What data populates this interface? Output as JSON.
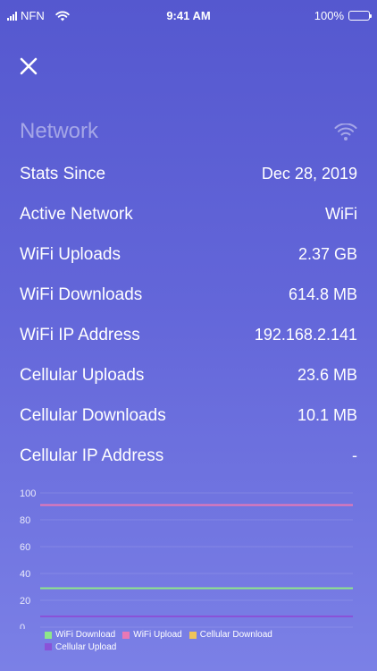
{
  "status_bar": {
    "carrier": "NFN",
    "time": "9:41 AM",
    "battery": "100%"
  },
  "header": {
    "title": "Network"
  },
  "stats": [
    {
      "label": "Stats Since",
      "value": "Dec 28, 2019"
    },
    {
      "label": "Active Network",
      "value": "WiFi"
    },
    {
      "label": "WiFi Uploads",
      "value": "2.37 GB"
    },
    {
      "label": "WiFi Downloads",
      "value": "614.8 MB"
    },
    {
      "label": "WiFi IP Address",
      "value": "192.168.2.141"
    },
    {
      "label": "Cellular Uploads",
      "value": "23.6 MB"
    },
    {
      "label": "Cellular Downloads",
      "value": "10.1 MB"
    },
    {
      "label": "Cellular IP Address",
      "value": "-"
    }
  ],
  "chart_data": {
    "type": "line",
    "title": "",
    "xlabel": "",
    "ylabel": "",
    "ylim": [
      0,
      100
    ],
    "yticks": [
      "100",
      "80",
      "60",
      "40",
      "20",
      "0"
    ],
    "grid": true,
    "legend_position": "bottom",
    "series": [
      {
        "name": "WiFi Download",
        "color": "#8ee68a",
        "values": [
          29,
          29
        ]
      },
      {
        "name": "WiFi Upload",
        "color": "#e978b5",
        "values": [
          91,
          91
        ]
      },
      {
        "name": "Cellular Download",
        "color": "#f0c45a",
        "values": [
          8,
          8
        ]
      },
      {
        "name": "Cellular Upload",
        "color": "#8a52d8",
        "values": [
          8,
          8
        ]
      }
    ]
  }
}
